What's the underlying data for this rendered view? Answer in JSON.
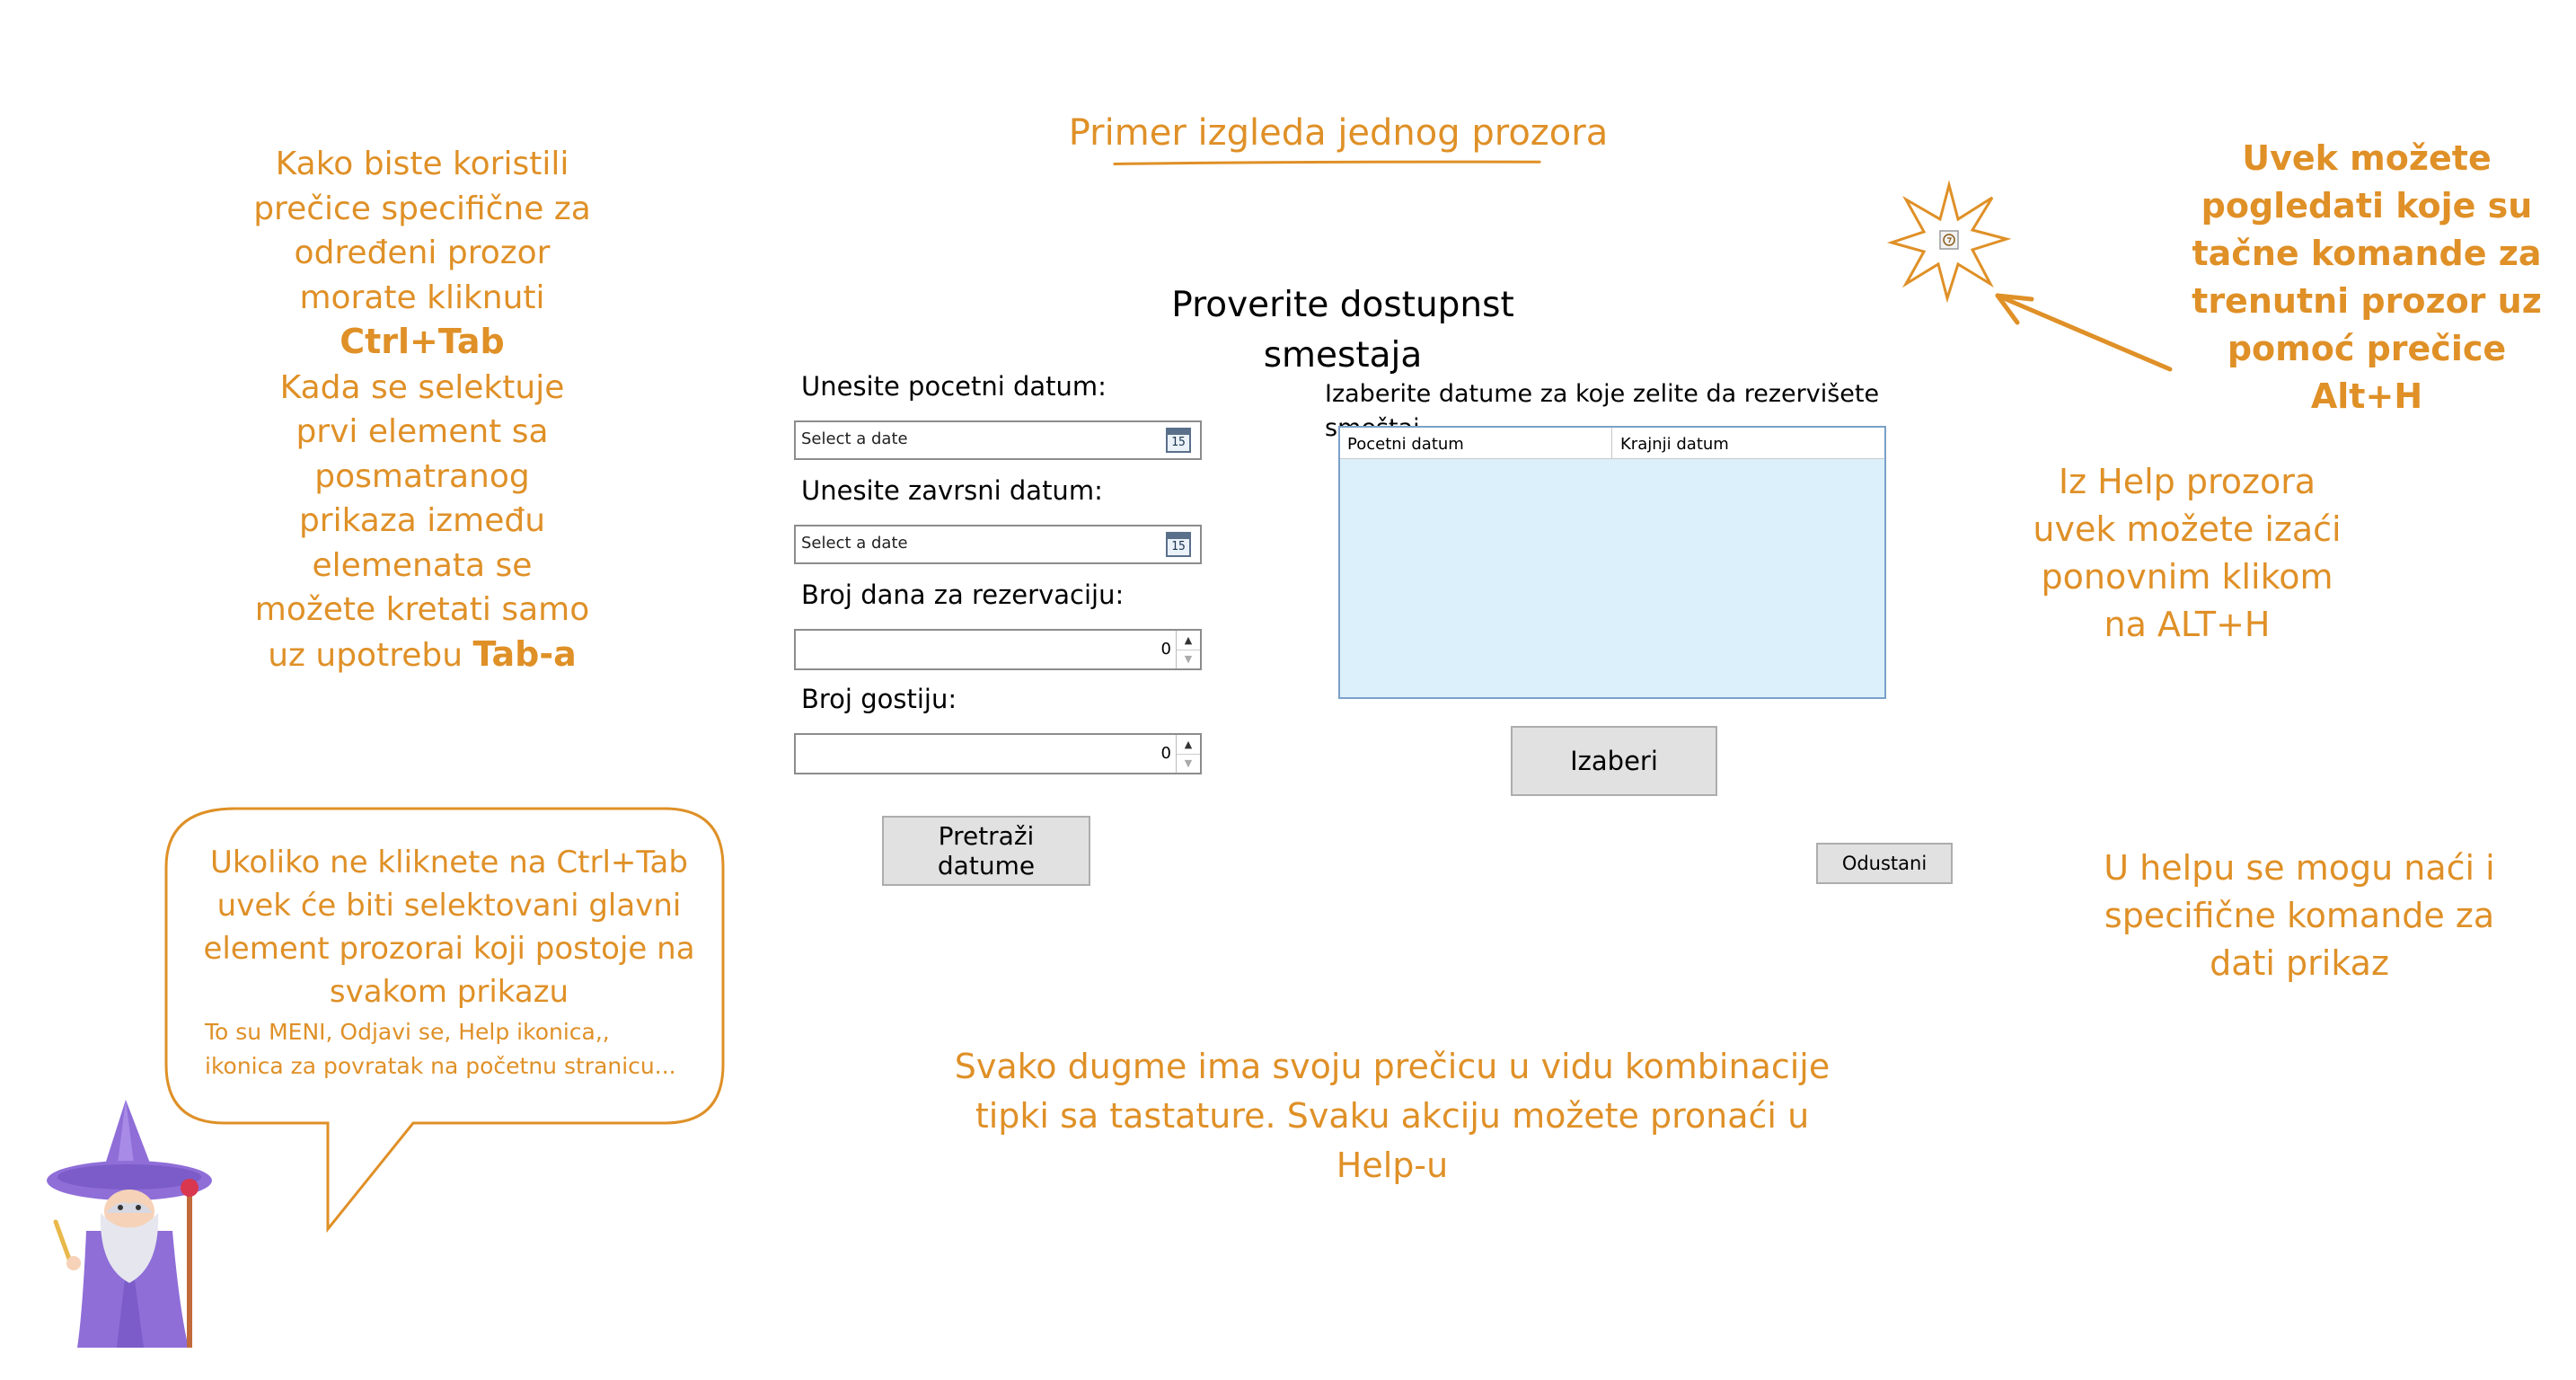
{
  "annotations": {
    "left_note": {
      "line1": "Kako biste koristili",
      "line2": "prečice specifične za",
      "line3": "određeni prozor",
      "line4": "morate kliknuti",
      "shortcut": "Ctrl+Tab",
      "line5": "Kada se selektuje",
      "line6": "prvi element sa",
      "line7": "posmatranog",
      "line8": "prikaza između",
      "line9": "elemenata se",
      "line10": "možete kretati samo",
      "line11": "uz upotrebu",
      "tab_word": "Tab-a"
    },
    "top_title": "Primer izgleda jednog prozora",
    "right_bold": {
      "line1": "Uvek možete",
      "line2": "pogledati koje su",
      "line3": "tačne komande za",
      "line4": "trenutni prozor uz",
      "line5": "pomoć prečice",
      "line6": "Alt+H"
    },
    "right_mid": {
      "line1": "Iz Help prozora",
      "line2": "uvek možete izaći",
      "line3": "ponovnim klikom",
      "line4": "na ALT+H"
    },
    "right_low": {
      "line1": "U helpu se mogu naći i",
      "line2": "specifične  komande za",
      "line3": "dati prikaz"
    },
    "bottom_center": {
      "line1": "Svako dugme ima svoju prečicu u vidu kombinacije",
      "line2": "tipki sa tastature. Svaku akciju možete pronaći u Help-u"
    },
    "bubble": {
      "line1": "Ukoliko ne kliknete na Ctrl+Tab",
      "line2": "uvek će biti selektovani glavni",
      "line3": "element prozorai koji postoje na",
      "line4": "svakom prikazu",
      "small1": "To su MENI,  Odjavi se, Help ikonica,,",
      "small2": "ikonica za povratak na početnu stranicu..."
    }
  },
  "window": {
    "title": "Proverite dostupnst smestaja",
    "start_date_label": "Unesite pocetni datum:",
    "start_date_placeholder": "Select a date",
    "end_date_label": "Unesite zavrsni datum:",
    "end_date_placeholder": "Select a date",
    "calendar_day": "15",
    "days_label": "Broj dana za rezervaciju:",
    "days_value": "0",
    "guests_label": "Broj gostiju:",
    "guests_value": "0",
    "search_button": "Pretraži datume",
    "grid_caption": "Izaberite datume za koje zelite da rezervišete smeštaj",
    "grid_columns": [
      "Pocetni datum",
      "Krajnji datum"
    ],
    "select_button": "Izaberi",
    "cancel_button": "Odustani"
  },
  "colors": {
    "annotation": "#df9027",
    "grid_background": "#dcf0fb",
    "button_background": "#e1e1e1",
    "wizard_robe": "#8f6ed8"
  },
  "icons": [
    "calendar-icon",
    "help-star-icon",
    "arrow-icon",
    "wizard-icon"
  ]
}
